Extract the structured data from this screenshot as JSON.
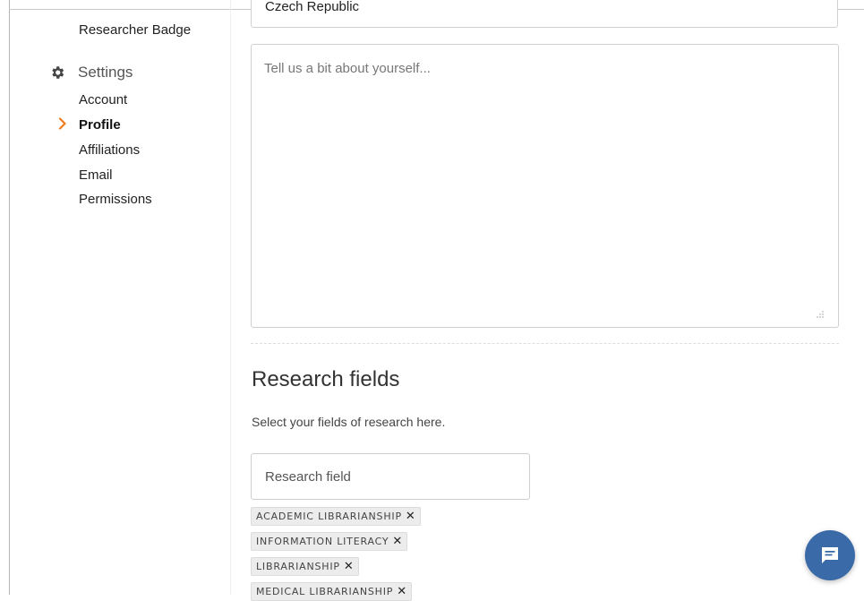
{
  "sidebar": {
    "badge_link": "Researcher Badge",
    "settings_heading": "Settings",
    "items": [
      {
        "label": "Account",
        "active": false
      },
      {
        "label": "Profile",
        "active": true
      },
      {
        "label": "Affiliations",
        "active": false
      },
      {
        "label": "Email",
        "active": false
      },
      {
        "label": "Permissions",
        "active": false
      }
    ]
  },
  "profile": {
    "country_value": "Czech Republic",
    "bio_placeholder": "Tell us a bit about yourself...",
    "bio_value": ""
  },
  "research_fields": {
    "title": "Research fields",
    "subtitle": "Select your fields of research here.",
    "input_placeholder": "Research field",
    "tags": [
      "ACADEMIC LIBRARIANSHIP",
      "INFORMATION LITERACY",
      "LIBRARIANSHIP",
      "MEDICAL LIBRARIANSHIP"
    ],
    "remove_glyph": "✕"
  },
  "chat": {
    "icon": "chat-bubble-icon"
  },
  "colors": {
    "accent_arrow": "#f07c1c",
    "chat_button": "#3a6aa8",
    "tag_bg": "#ececec"
  }
}
